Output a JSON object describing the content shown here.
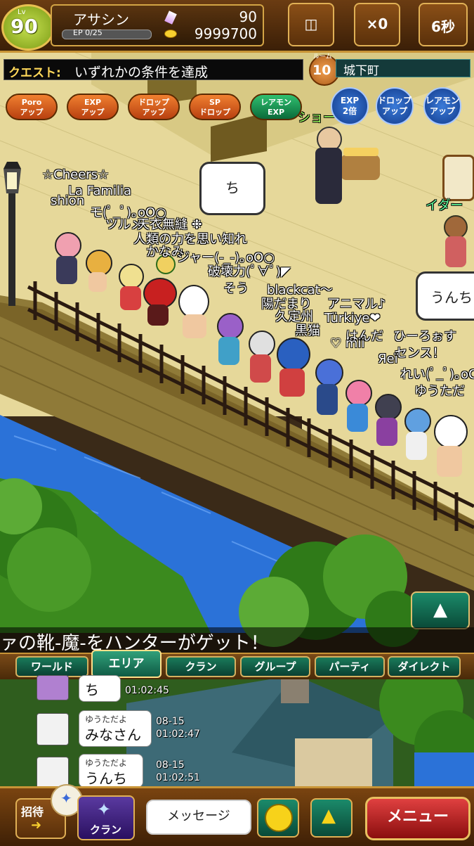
{
  "player": {
    "level_prefix": "Lv",
    "level": "90",
    "name": "アサシン",
    "ep_label": "EP 0/25",
    "ep_fraction": 0,
    "gems": "90",
    "gold": "9999700"
  },
  "top_buttons": {
    "gift_count": "×0",
    "timer": "6秒"
  },
  "quest": {
    "label": "クエスト:",
    "text": "いずれかの条件を達成"
  },
  "room": {
    "label": "ルーム",
    "number": "10",
    "location": "城下町"
  },
  "buffs": [
    {
      "line1": "Poro",
      "line2": "アップ"
    },
    {
      "line1": "EXP",
      "line2": "アップ"
    },
    {
      "line1": "ドロップ",
      "line2": "アップ"
    },
    {
      "line1": "SP",
      "line2": "ドロップ"
    },
    {
      "line1": "レアモン",
      "line2": "EXP"
    }
  ],
  "round_buffs": [
    {
      "line1": "EXP",
      "line2": "2倍"
    },
    {
      "line1": "ドロップ",
      "line2": "アップ"
    },
    {
      "line1": "レアモン",
      "line2": "アップ"
    }
  ],
  "world_labels": {
    "shop_partial": "ショー",
    "idar_partial": "イダー"
  },
  "speech_bubbles": {
    "top": "ち",
    "right": "うんち"
  },
  "player_names": [
    "☆Cheers☆",
    "La Familia",
    "shion",
    "モ(ﾟ_ﾟ)｡oO○",
    "ツルメ",
    "天衣無縫 ❉",
    "人類の力を思い知れ",
    "かなみ",
    "ジャー(-_-)｡oO○",
    "破壊力(ﾟ∀ﾟ)◤",
    "そう",
    "blackcat〜",
    "陽だまり",
    "アニマル♪",
    "久定州",
    "Türkiye❤",
    "黒猫",
    "はんだ",
    "ひーろぉす",
    "♡ mii",
    "センス！",
    "Яeï",
    "れい(ﾟ_ﾟ)｡oO",
    "ゆうただ"
  ],
  "ticker": "ァの靴-魔-をハンターがゲット！",
  "chat_tabs": [
    "ワールド",
    "エリア",
    "クラン",
    "グループ",
    "パーティ",
    "ダイレクト"
  ],
  "active_tab": "エリア",
  "chat_messages": [
    {
      "speaker": "",
      "text": "ち",
      "date": "",
      "time": "01:02:45"
    },
    {
      "speaker": "ゆうただよ",
      "text": "みなさん",
      "date": "08-15",
      "time": "01:02:47"
    },
    {
      "speaker": "ゆうただよ",
      "text": "うんち",
      "date": "08-15",
      "time": "01:02:51"
    }
  ],
  "bottom": {
    "invite_label": "招待",
    "clan_label": "クラン",
    "message_placeholder": "メッセージ",
    "menu_label": "メニュー"
  },
  "colors": {
    "water": "#2a70d8",
    "grass": "#3c8a1e",
    "pavement": "#e8dc9e",
    "wall": "#8c7a3a",
    "ui_gold": "#c89436",
    "tab_green": "#0f5a44",
    "menu_red": "#c01818"
  }
}
